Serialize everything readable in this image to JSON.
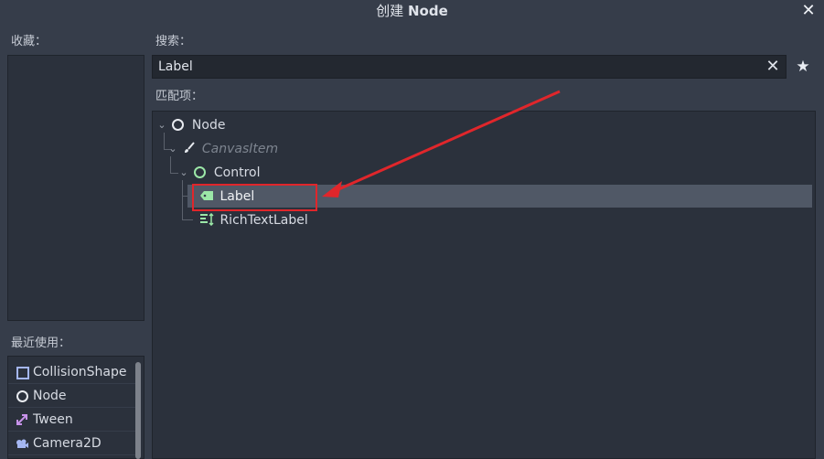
{
  "window": {
    "title_prefix": "创建",
    "title_node": "Node",
    "close_glyph": "✕"
  },
  "favorites": {
    "label": "收藏："
  },
  "recent": {
    "label": "最近使用：",
    "items": [
      {
        "label": "CollisionShape",
        "icon": "collision-shape-icon"
      },
      {
        "label": "Node",
        "icon": "node-icon"
      },
      {
        "label": "Tween",
        "icon": "tween-icon"
      },
      {
        "label": "Camera2D",
        "icon": "camera2d-icon"
      }
    ]
  },
  "search": {
    "label": "搜索：",
    "value": "Label",
    "clear_glyph": "✕",
    "favorite_glyph": "★"
  },
  "matches": {
    "label": "匹配项：",
    "tree": [
      {
        "label": "Node",
        "icon": "node-icon",
        "expanded": true
      },
      {
        "label": "CanvasItem",
        "icon": "canvas-item-icon",
        "expanded": true,
        "disabled": true
      },
      {
        "label": "Control",
        "icon": "control-icon",
        "expanded": true
      },
      {
        "label": "Label",
        "icon": "label-icon",
        "selected": true
      },
      {
        "label": "RichTextLabel",
        "icon": "rich-text-label-icon"
      }
    ]
  },
  "colors": {
    "background": "#363d4a",
    "panel": "#2b313c",
    "selection": "#505866",
    "annotation_red": "#e0262b",
    "control_green": "#9be7a7",
    "node2d_purple": "#a5b7f3"
  }
}
